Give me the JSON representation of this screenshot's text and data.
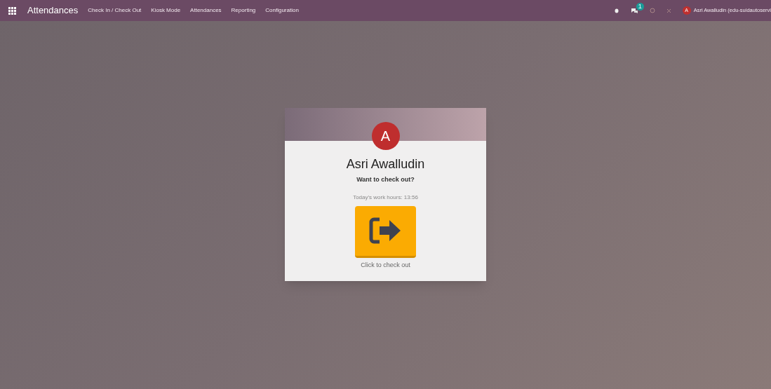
{
  "navbar": {
    "app_title": "Attendances",
    "menu": [
      {
        "label": "Check In / Check Out"
      },
      {
        "label": "Kiosk Mode"
      },
      {
        "label": "Attendances"
      },
      {
        "label": "Reporting"
      },
      {
        "label": "Configuration"
      }
    ],
    "message_count": "1",
    "user": {
      "initial": "A",
      "name": "Asri Awalludin (edu-suidautoservi"
    }
  },
  "card": {
    "avatar_initial": "A",
    "employee_name": "Asri Awalludin",
    "question": "Want to check out?",
    "work_hours": "Today's work hours: 13:56",
    "button_caption": "Click to check out"
  }
}
